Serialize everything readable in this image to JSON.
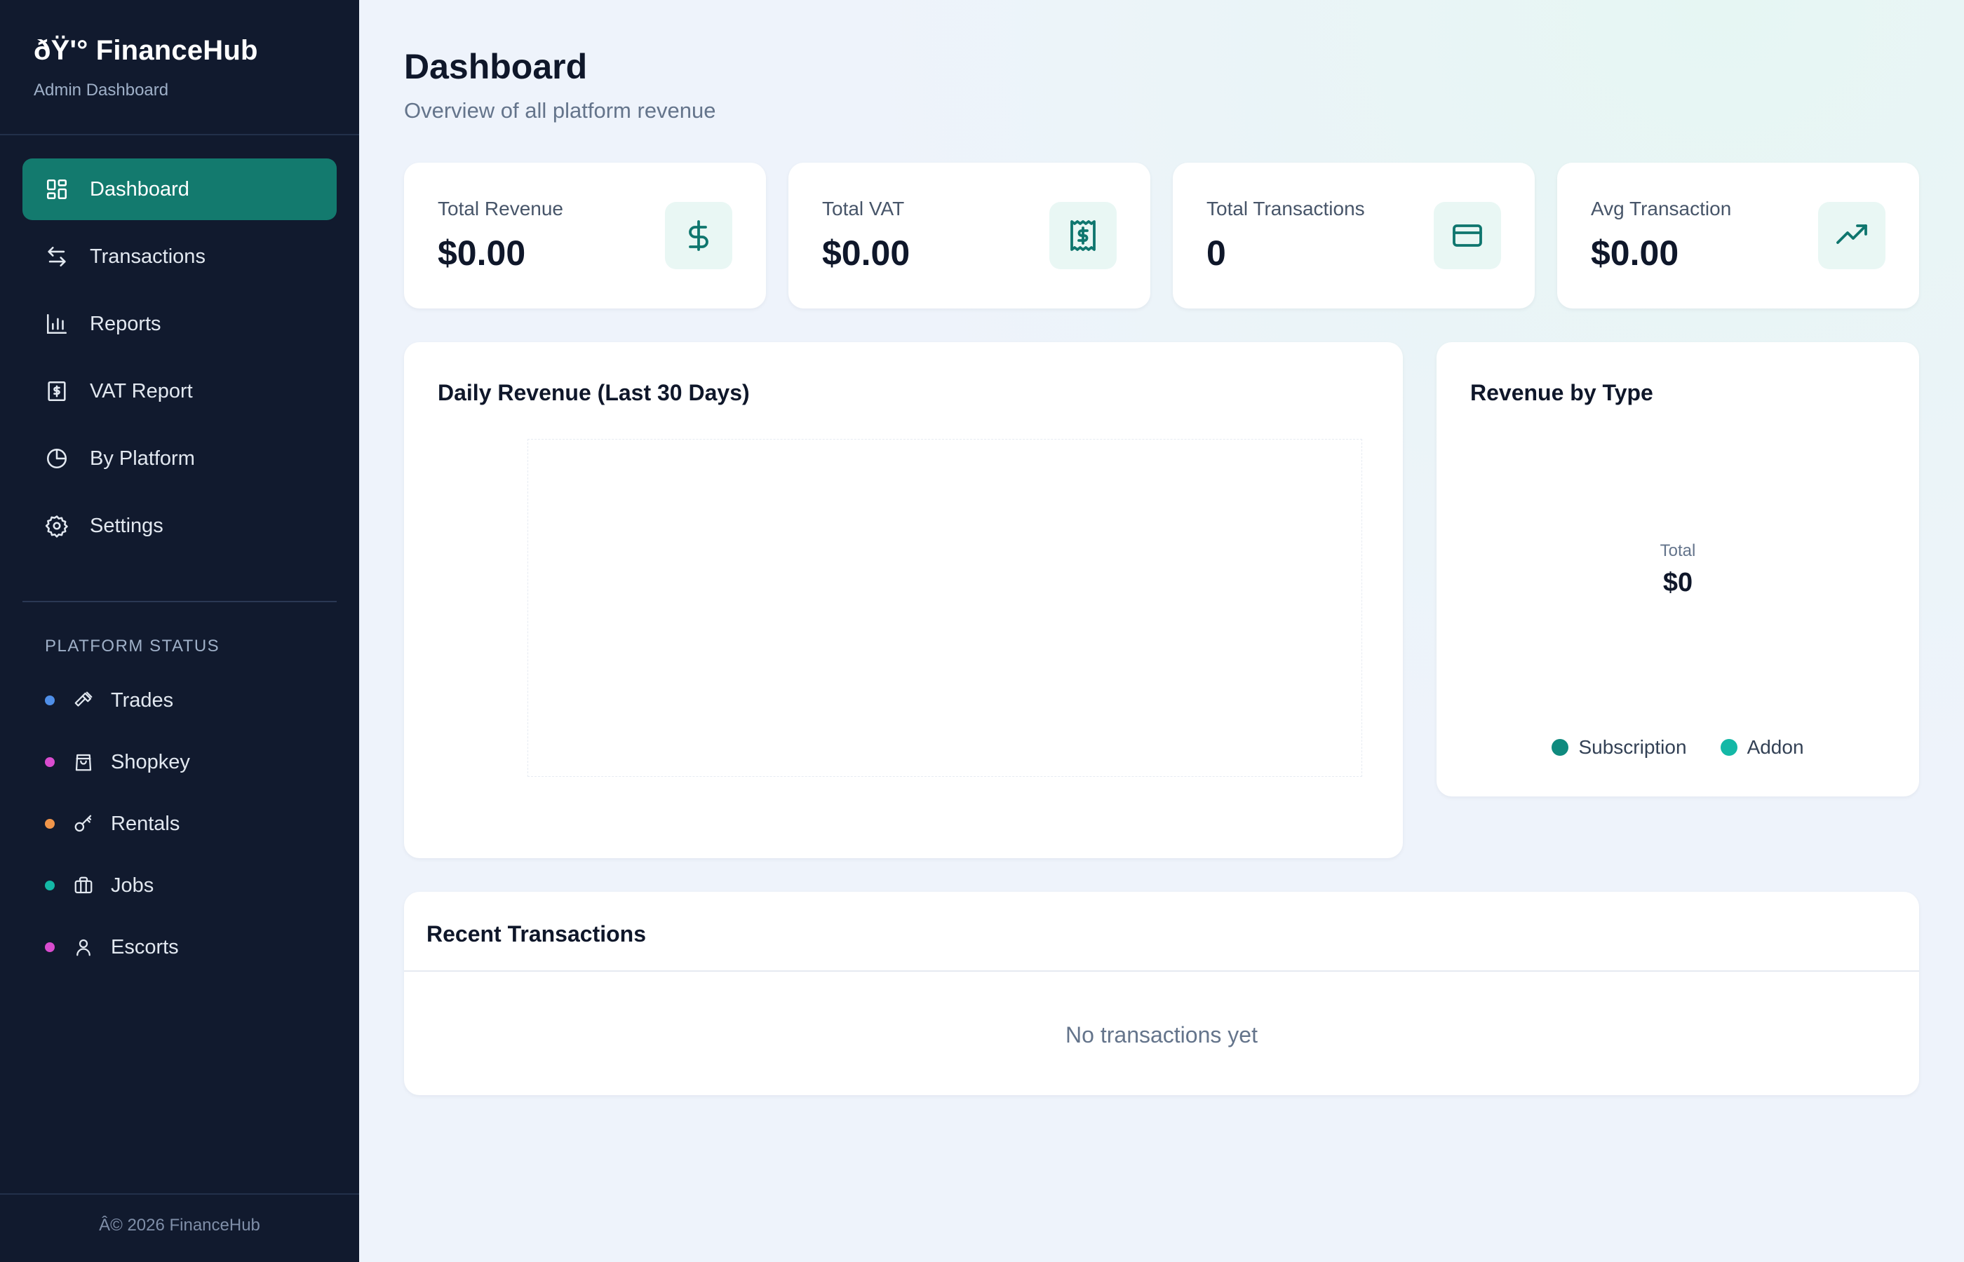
{
  "brand": {
    "title": "ðŸ'° FinanceHub",
    "subtitle": "Admin Dashboard"
  },
  "nav": [
    {
      "label": "Dashboard",
      "icon": "dashboard-grid-icon",
      "active": true
    },
    {
      "label": "Transactions",
      "icon": "arrows-swap-icon"
    },
    {
      "label": "Reports",
      "icon": "bar-chart-icon"
    },
    {
      "label": "VAT Report",
      "icon": "receipt-icon"
    },
    {
      "label": "By Platform",
      "icon": "pie-chart-icon"
    },
    {
      "label": "Settings",
      "icon": "gear-icon"
    }
  ],
  "platform_status": {
    "heading": "PLATFORM STATUS",
    "items": [
      {
        "label": "Trades",
        "color": "#4f8fe8",
        "icon": "hammer-icon"
      },
      {
        "label": "Shopkey",
        "color": "#d94ccf",
        "icon": "shopping-bag-icon"
      },
      {
        "label": "Rentals",
        "color": "#f0954a",
        "icon": "key-icon"
      },
      {
        "label": "Jobs",
        "color": "#14b8a6",
        "icon": "briefcase-icon"
      },
      {
        "label": "Escorts",
        "color": "#d94ccf",
        "icon": "user-icon"
      }
    ]
  },
  "footer": "Â© 2026 FinanceHub",
  "page": {
    "title": "Dashboard",
    "subtitle": "Overview of all platform revenue"
  },
  "stats": [
    {
      "label": "Total Revenue",
      "value": "$0.00",
      "icon": "dollar-icon"
    },
    {
      "label": "Total VAT",
      "value": "$0.00",
      "icon": "receipt-dollar-icon"
    },
    {
      "label": "Total Transactions",
      "value": "0",
      "icon": "credit-card-icon"
    },
    {
      "label": "Avg Transaction",
      "value": "$0.00",
      "icon": "trending-up-icon"
    }
  ],
  "daily_revenue": {
    "title": "Daily Revenue (Last 30 Days)"
  },
  "revenue_by_type": {
    "title": "Revenue by Type",
    "total_label": "Total",
    "total_value": "$0",
    "legend": [
      {
        "label": "Subscription",
        "color": "#0f8a7e"
      },
      {
        "label": "Addon",
        "color": "#14b8a6"
      }
    ]
  },
  "recent_transactions": {
    "title": "Recent Transactions",
    "empty_text": "No transactions yet"
  },
  "colors": {
    "sidebar_bg": "#111a2e",
    "accent": "#137a6e",
    "icon_teal": "#0f766e"
  }
}
